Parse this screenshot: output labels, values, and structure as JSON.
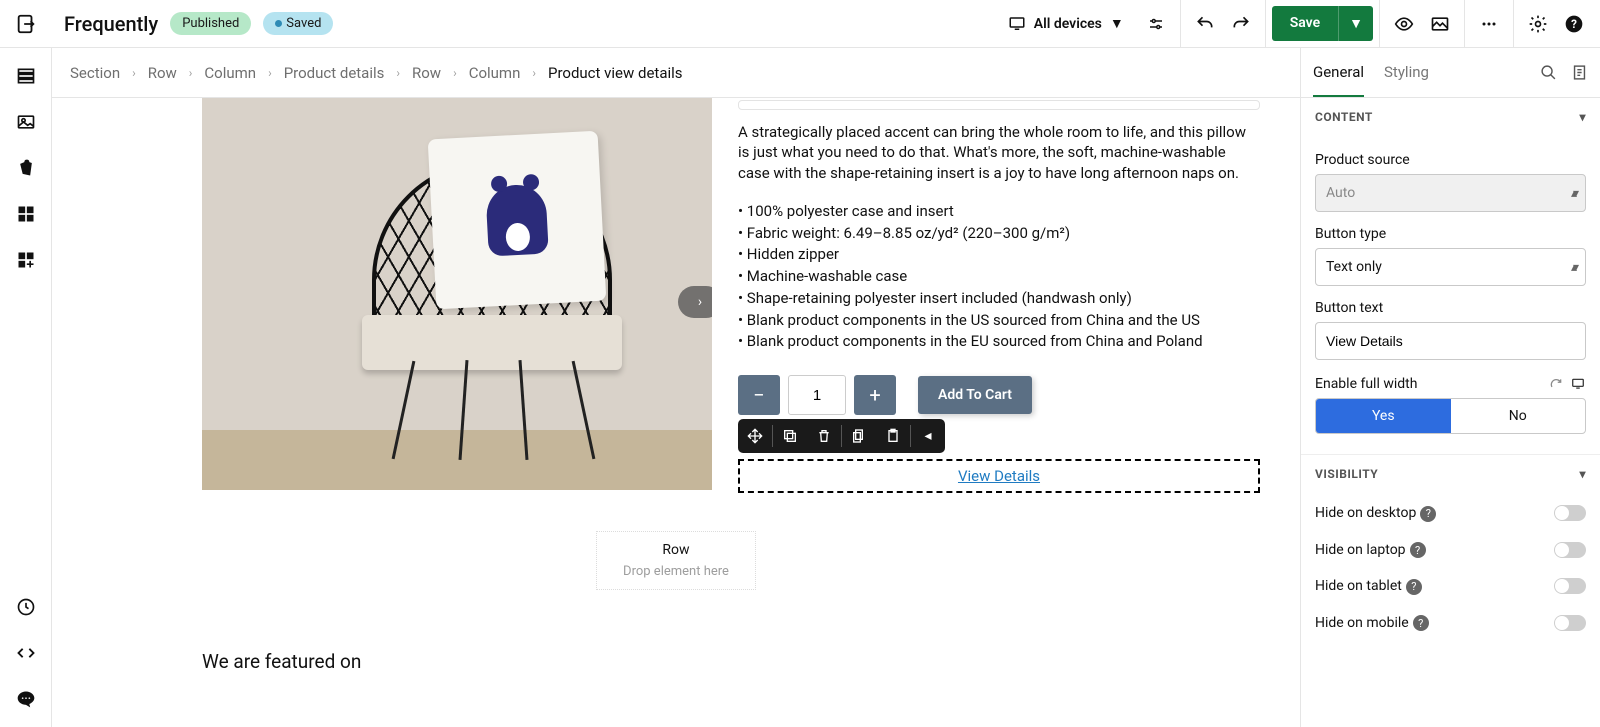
{
  "header": {
    "title": "Frequently",
    "published_badge": "Published",
    "saved_badge": "Saved",
    "device_selector": "All devices",
    "save_label": "Save"
  },
  "breadcrumb": [
    "Section",
    "Row",
    "Column",
    "Product details",
    "Row",
    "Column",
    "Product view details"
  ],
  "product": {
    "description": "A strategically placed accent can bring the whole room to life, and this pillow is just what you need to do that. What's more, the soft, machine-washable case with the shape-retaining insert is a joy to have long afternoon naps on.",
    "bullets": [
      "100% polyester case and insert",
      "Fabric weight: 6.49–8.85 oz/yd² (220–300 g/m²)",
      "Hidden zipper",
      "Machine-washable case",
      "Shape-retaining polyester insert included (handwash only)",
      "Blank product components in the US sourced from China and the US",
      "Blank product components in the EU sourced from China and Poland"
    ],
    "quantity": "1",
    "add_to_cart": "Add To Cart",
    "view_details": "View Details"
  },
  "drop_zone": {
    "title": "Row",
    "hint": "Drop element here"
  },
  "featured_heading": "We are featured on",
  "panel": {
    "tabs": {
      "general": "General",
      "styling": "Styling"
    },
    "content_header": "CONTENT",
    "product_source_label": "Product source",
    "product_source_value": "Auto",
    "button_type_label": "Button type",
    "button_type_value": "Text only",
    "button_text_label": "Button text",
    "button_text_value": "View Details",
    "full_width_label": "Enable full width",
    "yes": "Yes",
    "no": "No",
    "visibility_header": "VISIBILITY",
    "hide_desktop": "Hide on desktop",
    "hide_laptop": "Hide on laptop",
    "hide_tablet": "Hide on tablet",
    "hide_mobile": "Hide on mobile"
  }
}
